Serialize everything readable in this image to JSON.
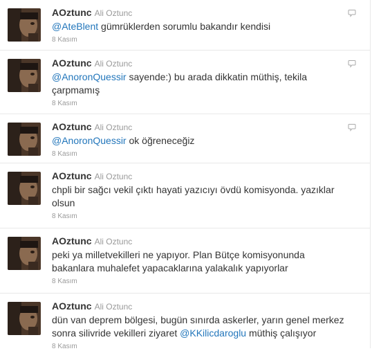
{
  "tweets": [
    {
      "screen_name": "AOztunc",
      "full_name": "Ali Oztunc",
      "mention": "@AteBlent",
      "text_after": " gümrüklerden sorumlu bakandır kendisi",
      "timestamp": "8 Kasım",
      "has_reply_icon": true
    },
    {
      "screen_name": "AOztunc",
      "full_name": "Ali Oztunc",
      "mention": "@AnoronQuessir",
      "text_after": " sayende:) bu arada dikkatin müthiş, tekila çarpmamış",
      "timestamp": "8 Kasım",
      "has_reply_icon": true
    },
    {
      "screen_name": "AOztunc",
      "full_name": "Ali Oztunc",
      "mention": "@AnoronQuessir",
      "text_after": " ok öğreneceğiz",
      "timestamp": "8 Kasım",
      "has_reply_icon": true
    },
    {
      "screen_name": "AOztunc",
      "full_name": "Ali Oztunc",
      "text": "chpli bir sağcı vekil çıktı hayati yazıcıyı övdü komisyonda. yazıklar olsun",
      "timestamp": "8 Kasım"
    },
    {
      "screen_name": "AOztunc",
      "full_name": "Ali Oztunc",
      "text": "peki ya milletvekilleri ne yapıyor. Plan Bütçe komisyonunda bakanlara muhalefet yapacaklarına yalakalık yapıyorlar",
      "timestamp": "8 Kasım"
    },
    {
      "screen_name": "AOztunc",
      "full_name": "Ali Oztunc",
      "text_before": "dün van deprem bölgesi, bugün sınırda askerler, yarın genel merkez sonra silivride vekilleri ziyaret ",
      "mention": "@KKilicdaroglu",
      "text_after": " müthiş çalışıyor",
      "timestamp": "8 Kasım"
    }
  ]
}
